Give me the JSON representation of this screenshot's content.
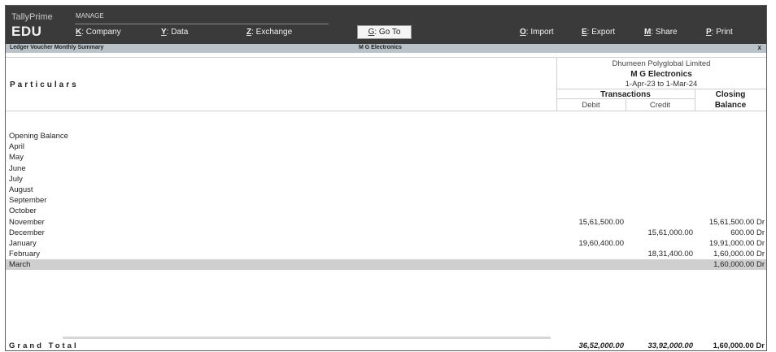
{
  "app": {
    "brand_top": "TallyPrime",
    "brand_bottom": "EDU",
    "manage": "MANAGE"
  },
  "menu": {
    "company": {
      "key": "K",
      "label": ": Company"
    },
    "data": {
      "key": "Y",
      "label": ": Data"
    },
    "exchange": {
      "key": "Z",
      "label": ": Exchange"
    },
    "goto": {
      "key": "G",
      "label": ": Go To"
    },
    "import": {
      "key": "O",
      "label": ": Import"
    },
    "export": {
      "key": "E",
      "label": ": Export"
    },
    "share": {
      "key": "M",
      "label": ": Share"
    },
    "print": {
      "key": "P",
      "label": ": Print"
    }
  },
  "subheader": {
    "report": "Ledger Voucher Monthly Summary",
    "ledger": "M G Electronics",
    "close": "x"
  },
  "header": {
    "particulars": "Particulars",
    "company": "Dhumeen Polyglobal Limited",
    "ledger": "M G Electronics",
    "period": "1-Apr-23 to 1-Mar-24",
    "transactions": "Transactions",
    "debit": "Debit",
    "credit": "Credit",
    "closing_1": "Closing",
    "closing_2": "Balance"
  },
  "rows": [
    {
      "name": "Opening Balance",
      "debit": "",
      "credit": "",
      "closing": ""
    },
    {
      "name": "April",
      "debit": "",
      "credit": "",
      "closing": ""
    },
    {
      "name": "May",
      "debit": "",
      "credit": "",
      "closing": ""
    },
    {
      "name": "June",
      "debit": "",
      "credit": "",
      "closing": ""
    },
    {
      "name": "July",
      "debit": "",
      "credit": "",
      "closing": ""
    },
    {
      "name": "August",
      "debit": "",
      "credit": "",
      "closing": ""
    },
    {
      "name": "September",
      "debit": "",
      "credit": "",
      "closing": ""
    },
    {
      "name": "October",
      "debit": "",
      "credit": "",
      "closing": ""
    },
    {
      "name": "November",
      "debit": "15,61,500.00",
      "credit": "",
      "closing": "15,61,500.00 Dr"
    },
    {
      "name": "December",
      "debit": "",
      "credit": "15,61,000.00",
      "closing": "600.00 Dr"
    },
    {
      "name": "January",
      "debit": "19,60,400.00",
      "credit": "",
      "closing": "19,91,000.00 Dr"
    },
    {
      "name": "February",
      "debit": "",
      "credit": "18,31,400.00",
      "closing": "1,60,000.00 Dr"
    },
    {
      "name": "March",
      "debit": "",
      "credit": "",
      "closing": "1,60,000.00 Dr"
    }
  ],
  "total": {
    "name": "Grand Total",
    "debit": "36,52,000.00",
    "credit": "33,92,000.00",
    "closing": "1,60,000.00 Dr"
  }
}
